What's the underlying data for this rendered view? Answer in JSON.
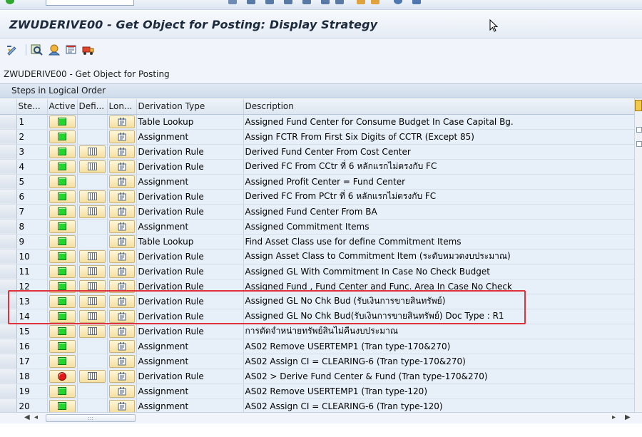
{
  "window": {
    "title": "ZWUDERIVE00 - Get Object for Posting: Display Strategy"
  },
  "screen_label": "ZWUDERIVE00 - Get Object for Posting",
  "grid": {
    "title": "Steps in Logical Order",
    "columns": [
      "Ste...",
      "Active",
      "Defi...",
      "Lon...",
      "Derivation Type",
      "Description"
    ],
    "rows": [
      {
        "step": "1",
        "active": "green",
        "def": false,
        "type": "Table Lookup",
        "desc": "Assigned Fund Center for Consume Budget In Case Capital Bg."
      },
      {
        "step": "2",
        "active": "green",
        "def": false,
        "type": "Assignment",
        "desc": "Assign FCTR From First Six Digits of CCTR (Except 85)"
      },
      {
        "step": "3",
        "active": "green",
        "def": true,
        "type": "Derivation Rule",
        "desc": "Derived Fund Center From Cost Center"
      },
      {
        "step": "4",
        "active": "green",
        "def": true,
        "type": "Derivation Rule",
        "desc": "Derived FC From CCtr ที่ 6 หลักแรกไม่ตรงกับ FC"
      },
      {
        "step": "5",
        "active": "green",
        "def": false,
        "type": "Assignment",
        "desc": "Assigned Profit Center = Fund Center"
      },
      {
        "step": "6",
        "active": "green",
        "def": true,
        "type": "Derivation Rule",
        "desc": "Derived FC From PCtr ที่ 6 หลักแรกไม่ตรงกับ FC"
      },
      {
        "step": "7",
        "active": "green",
        "def": true,
        "type": "Derivation Rule",
        "desc": "Assigned Fund Center From BA"
      },
      {
        "step": "8",
        "active": "green",
        "def": false,
        "type": "Assignment",
        "desc": "Assigned Commitment Items"
      },
      {
        "step": "9",
        "active": "green",
        "def": false,
        "type": "Table Lookup",
        "desc": "Find Asset Class use for define Commitment Items"
      },
      {
        "step": "10",
        "active": "green",
        "def": true,
        "type": "Derivation Rule",
        "desc": "Assign Asset Class to Commitment Item (ระดับหมวดงบประมาณ)"
      },
      {
        "step": "11",
        "active": "green",
        "def": true,
        "type": "Derivation Rule",
        "desc": "Assigned GL With Commitment In Case No Check Budget"
      },
      {
        "step": "12",
        "active": "green",
        "def": true,
        "type": "Derivation Rule",
        "desc": "Assigned Fund , Fund Center and Func. Area In Case No Check"
      },
      {
        "step": "13",
        "active": "green",
        "def": true,
        "type": "Derivation Rule",
        "desc": "Assigned GL No Chk Bud (รับเงินการขายสินทรัพย์)"
      },
      {
        "step": "14",
        "active": "green",
        "def": true,
        "type": "Derivation Rule",
        "desc": "Assigned GL No Chk Bud(รับเงินการขายสินทรัพย์) Doc Type : R1"
      },
      {
        "step": "15",
        "active": "green",
        "def": true,
        "type": "Derivation Rule",
        "desc": "การตัดจำหน่ายทรัพย์สินไม่คืนงบประมาณ"
      },
      {
        "step": "16",
        "active": "green",
        "def": false,
        "type": "Assignment",
        "desc": "AS02 Remove USERTEMP1 (Tran type-170&270)"
      },
      {
        "step": "17",
        "active": "green",
        "def": false,
        "type": "Assignment",
        "desc": "AS02 Assign CI = CLEARING-6 (Tran type-170&270)"
      },
      {
        "step": "18",
        "active": "red",
        "def": true,
        "type": "Derivation Rule",
        "desc": "AS02 > Derive Fund Center & Fund (Tran type-170&270)"
      },
      {
        "step": "19",
        "active": "green",
        "def": false,
        "type": "Assignment",
        "desc": "AS02 Remove USERTEMP1 (Tran type-120)"
      },
      {
        "step": "20",
        "active": "green",
        "def": false,
        "type": "Assignment",
        "desc": "AS02 Assign CI = CLEARING-6 (Tran type-120)"
      }
    ]
  },
  "scroll": {
    "thumb_label": ":::"
  },
  "colors": {
    "highlight_box": "#e0323a",
    "light_green": "#23d62b",
    "light_red": "#e51616"
  }
}
